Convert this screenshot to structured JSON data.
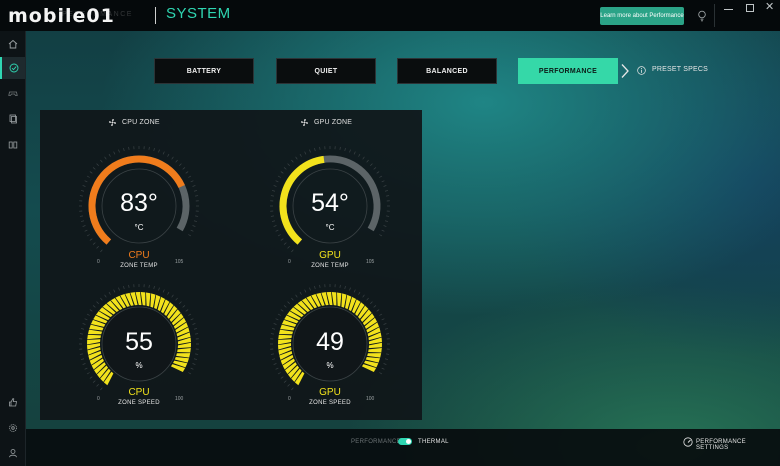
{
  "header": {
    "logo_text": "mobile01",
    "logo_strip": "PERFORMANCE",
    "title": "SYSTEM",
    "learn_more": "Learn more about Performance"
  },
  "sidebar": {
    "items": [
      {
        "icon": "home-icon"
      },
      {
        "icon": "gauge-icon",
        "active": true
      },
      {
        "icon": "gamepad-icon"
      },
      {
        "icon": "copy-icon"
      },
      {
        "icon": "dual-screen-icon"
      },
      {
        "icon": "thumbs-up-icon"
      },
      {
        "icon": "gear-icon"
      },
      {
        "icon": "user-icon"
      }
    ]
  },
  "modes": {
    "items": [
      "BATTERY",
      "QUIET",
      "BALANCED",
      "PERFORMANCE"
    ],
    "active": "PERFORMANCE",
    "preset_label": "PRESET SPECS"
  },
  "zones": {
    "cpu": "CPU ZONE",
    "gpu": "GPU ZONE"
  },
  "gauges": {
    "cpu_temp": {
      "value": "83°",
      "unit": "°C",
      "name": "CPU",
      "sub": "ZONE TEMP",
      "min": "0",
      "max": "105",
      "level": 0.79,
      "color": "#f07c1c"
    },
    "gpu_temp": {
      "value": "54°",
      "unit": "°C",
      "name": "GPU",
      "sub": "ZONE TEMP",
      "min": "0",
      "max": "105",
      "level": 0.51,
      "color": "#f2e21c"
    },
    "cpu_speed": {
      "value": "55",
      "unit": "%",
      "name": "CPU",
      "sub": "ZONE SPEED",
      "min": "0",
      "max": "100",
      "level": 1.0,
      "color": "#f2e21c"
    },
    "gpu_speed": {
      "value": "49",
      "unit": "%",
      "name": "GPU",
      "sub": "ZONE SPEED",
      "min": "0",
      "max": "100",
      "level": 1.0,
      "color": "#f2e21c"
    }
  },
  "footer": {
    "toggle_left": "PERFORMANCE",
    "toggle_right": "THERMAL",
    "settings": "PERFORMANCE SETTINGS"
  },
  "colors": {
    "accent": "#2fd6b2",
    "cpu_temp": "#f07c1c",
    "gpu": "#f2e21c"
  }
}
